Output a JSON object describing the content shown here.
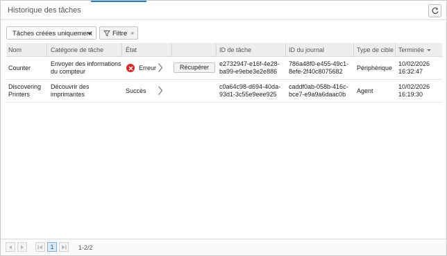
{
  "panel": {
    "title": "Historique des tâches"
  },
  "toolbar": {
    "dropdown_value": "Tâches créées uniquement",
    "filter_label": "Filtre"
  },
  "table": {
    "headers": {
      "name": "Nom",
      "category": "Catégorie de tâche",
      "state": "État",
      "task_id": "ID de tâche",
      "log_id": "ID du journal",
      "target_type": "Type de cible",
      "finished": "Terminée"
    },
    "sorted_column": "finished",
    "sort_direction": "descending",
    "rows": [
      {
        "name": "Counter",
        "category_line1": "Envoyer des informations",
        "category_line2": "du compteur",
        "state": "Erreur",
        "state_icon": "error-icon",
        "action_label": "Récupérer",
        "task_id_line1": "e2732947-e16f-4e28-",
        "task_id_line2": "ba99-e9ebe3e2e886",
        "log_id_line1": "786a48f0-e455-49c1-",
        "log_id_line2": "8efe-2f40c8075682",
        "target_type": "Périphérique",
        "finished_date": "10/02/2026",
        "finished_time": "16:32:47"
      },
      {
        "name_line1": "Discovering",
        "name_line2": "Printers",
        "category_line1": "Découvrir des",
        "category_line2": "imprimantes",
        "state": "Succès",
        "task_id_line1": "c0a64c98-d694-40da-",
        "task_id_line2": "93d1-3c55e9eee925",
        "log_id_line1": "caddf0ab-058b-416c-",
        "log_id_line2": "bce7-e9a9a6daac0b",
        "target_type": "Agent",
        "finished_date": "10/02/2026",
        "finished_time": "16:19:30"
      }
    ]
  },
  "pagination": {
    "current_page": "1",
    "range_info": "1-2/2"
  },
  "colors": {
    "accent": "#2a7ec0",
    "error": "#d32828",
    "header_bg": "#eeeeee"
  }
}
